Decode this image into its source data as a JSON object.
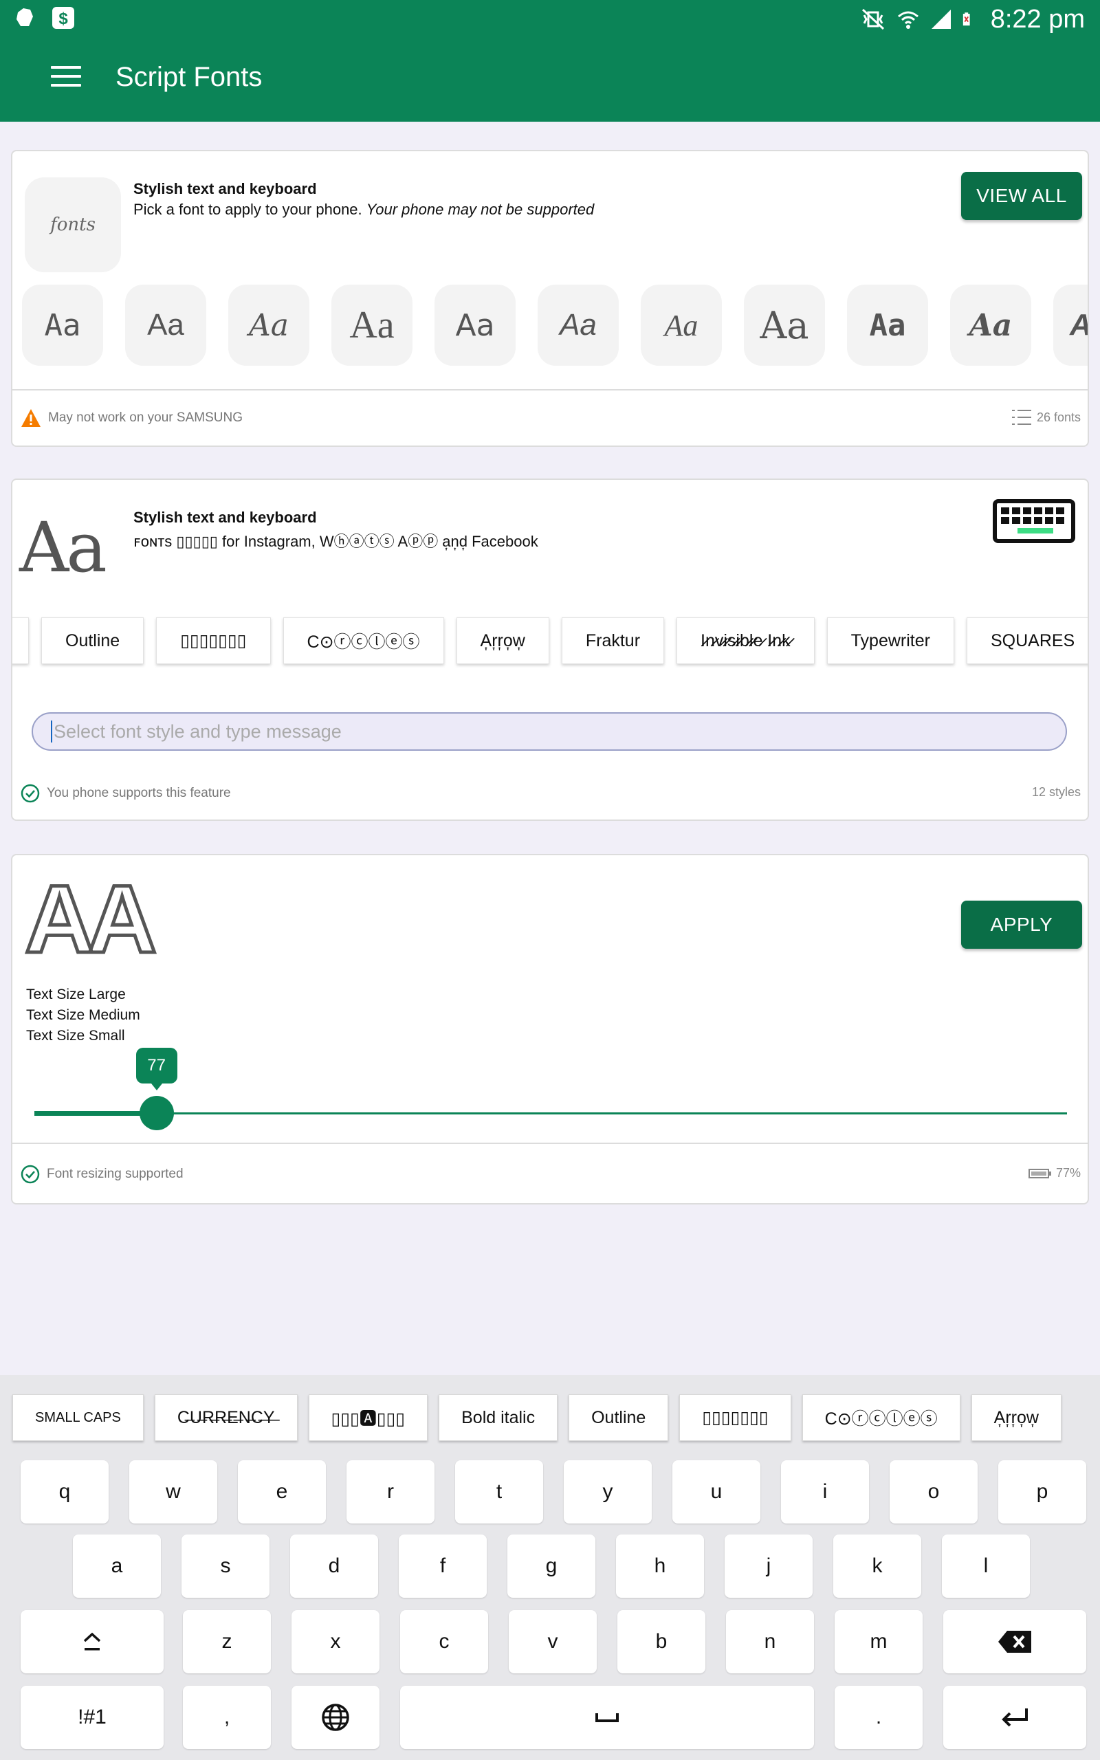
{
  "status_bar": {
    "time": "8:22 pm",
    "left_icons": [
      "evernote-icon",
      "dollar-app-icon"
    ],
    "right_icons": [
      "vibrate-mute-icon",
      "wifi-icon",
      "signal-icon",
      "battery-icon"
    ]
  },
  "app_bar": {
    "title": "Script Fonts",
    "menu_icon": "hamburger-menu-icon"
  },
  "colors": {
    "primary": "#0B8457",
    "button": "#0A6E47",
    "background": "#F1EFF8",
    "warning": "#F57C00"
  },
  "card_fonts": {
    "badge": "fonts",
    "title": "Stylish text and keyboard",
    "subtitle": "Pick a font to apply to your phone.",
    "subtitle_note": "Your phone may not be supported",
    "view_all": "VIEW ALL",
    "samples": [
      "Aa",
      "Aa",
      "Aa",
      "Aa",
      "Aa",
      "Aa",
      "Aa",
      "Aa",
      "Aa",
      "Aa",
      "A"
    ],
    "warning": "May not work on your SAMSUNG",
    "count": "26 fonts"
  },
  "card_styles": {
    "big_sample": "Aa",
    "title": "Stylish text and keyboard",
    "subtitle": "ꜰᴏɴᴛs ▯▯▯▯▯ for Instagram, Wⓗⓐⓣⓢ Aⓟⓟ a͎n͎d͎ Facebook",
    "chips": [
      "Outline",
      "▯▯▯▯▯▯▯",
      "C⊙ⓡⓒⓛⓔⓢ",
      "A͎r͎r͎o͎w͎",
      "Fraktur",
      "I̷n̷v̷i̷s̷i̷b̷l̷e̷ I̷n̷k̷",
      "Typewriter",
      "SQUARES"
    ],
    "input_placeholder": "Select font style and type message",
    "support": "You phone supports this feature",
    "count": "12 styles"
  },
  "card_size": {
    "sample": "AA",
    "apply": "APPLY",
    "sizes": [
      "Text Size Large",
      "Text Size Medium",
      "Text Size Small"
    ],
    "slider_value": "77",
    "slider_fraction": 0.077,
    "support": "Font resizing supported",
    "percent": "77%"
  },
  "keyboard": {
    "suggestions": [
      "SMALL CAPS",
      "C̶U̶R̶R̶E̶N̶C̶Y̶",
      "▯▯▯🅰▯▯▯",
      "Bold italic",
      "Outline",
      "▯▯▯▯▯▯▯",
      "C⊙ⓡⓒⓛⓔⓢ",
      "A͎r͎r͎o͎w͎"
    ],
    "row1": [
      "q",
      "w",
      "e",
      "r",
      "t",
      "y",
      "u",
      "i",
      "o",
      "p"
    ],
    "row2": [
      "a",
      "s",
      "d",
      "f",
      "g",
      "h",
      "j",
      "k",
      "l"
    ],
    "row3": [
      "z",
      "x",
      "c",
      "v",
      "b",
      "n",
      "m"
    ],
    "symbols_key": "!#1",
    "comma_key": ",",
    "period_key": ".",
    "shift_icon": "shift-icon",
    "backspace_icon": "backspace-icon",
    "globe_icon": "globe-icon",
    "space_icon": "space-icon",
    "enter_icon": "enter-icon"
  }
}
